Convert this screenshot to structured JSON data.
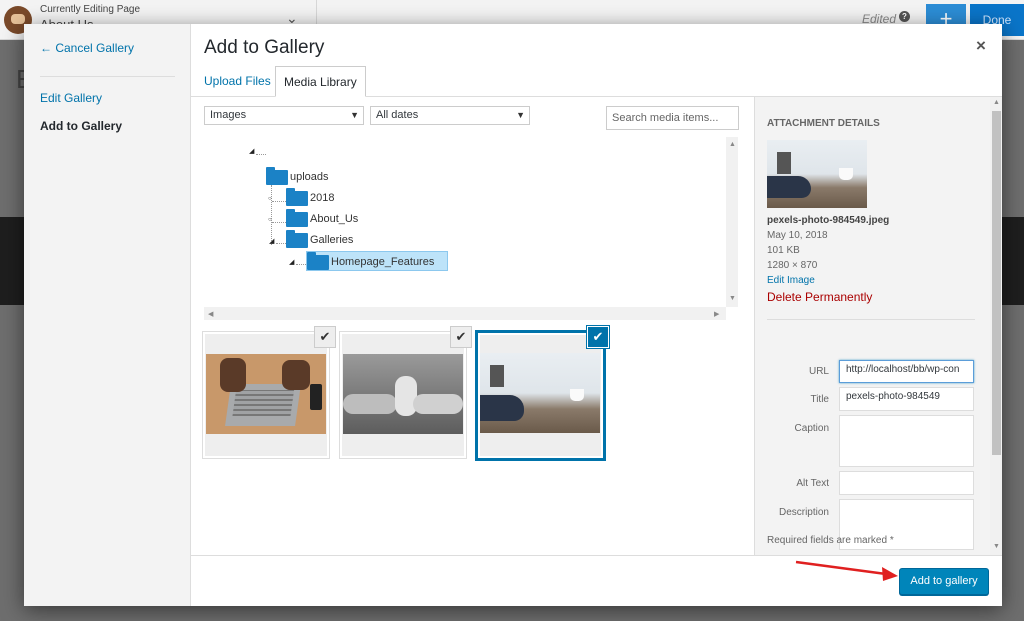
{
  "builder": {
    "editing_label": "Currently Editing Page",
    "page_name": "About Us",
    "status": "Edited",
    "done_label": "Done",
    "ghost_letter": "E"
  },
  "menu": {
    "cancel": "← Cancel Gallery",
    "edit": "Edit Gallery",
    "add": "Add to Gallery"
  },
  "modal": {
    "title": "Add to Gallery",
    "close_label": "×",
    "tabs": [
      "Upload Files",
      "Media Library"
    ]
  },
  "filters": {
    "type": "Images",
    "date": "All dates",
    "search_placeholder": "Search media items..."
  },
  "folders": {
    "root": "uploads",
    "items": [
      "2018",
      "About_Us",
      "Galleries"
    ],
    "selected": "Homepage_Features"
  },
  "attachment": {
    "heading": "Attachment Details",
    "filename": "pexels-photo-984549.jpeg",
    "date": "May 10, 2018",
    "size": "101 KB",
    "dimensions": "1280 × 870",
    "edit_link": "Edit Image",
    "delete_link": "Delete Permanently",
    "labels": {
      "url": "URL",
      "title": "Title",
      "caption": "Caption",
      "alt": "Alt Text",
      "description": "Description"
    },
    "values": {
      "url": "http://localhost/bb/wp-con",
      "title": "pexels-photo-984549",
      "caption": "",
      "alt": "",
      "description": ""
    },
    "required_note": "Required fields are marked *"
  },
  "actions": {
    "add_to_gallery": "Add to gallery"
  },
  "colors": {
    "accent": "#0073aa",
    "button": "#0085ba",
    "delete": "#aa0000",
    "folder": "#1b82c6",
    "annotation_arrow": "#e02020"
  }
}
